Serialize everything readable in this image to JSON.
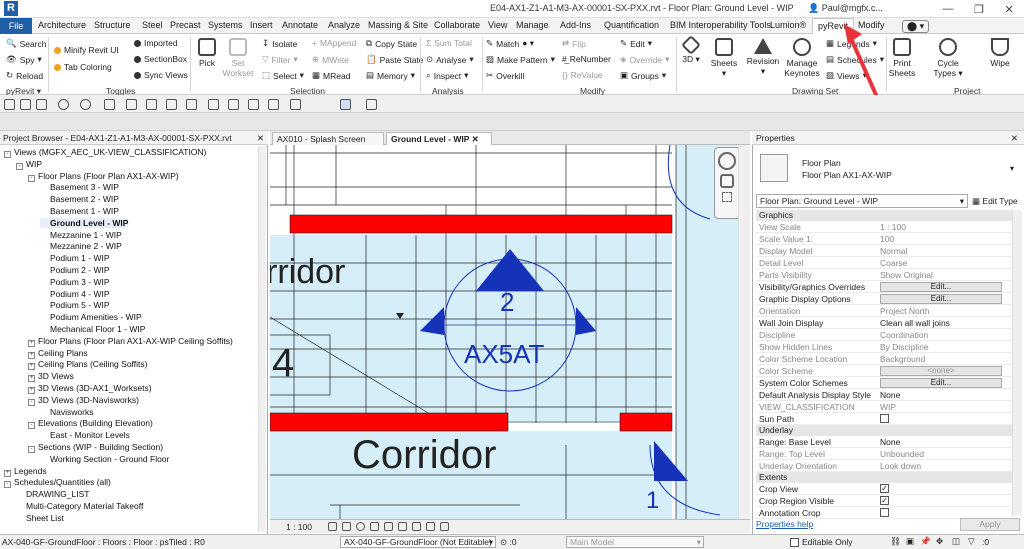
{
  "titlebar": {
    "doc_title": "E04-AX1-Z1-A1-M3-AX-00001-SX-PXX.rvt - Floor Plan: Ground Level - WIP",
    "user": "Paul@mgfx.c..."
  },
  "ribbon_tabs": [
    "Architecture",
    "Structure",
    "Steel",
    "Precast",
    "Systems",
    "Insert",
    "Annotate",
    "Analyze",
    "Massing & Site",
    "Collaborate",
    "View",
    "Manage",
    "Add-Ins",
    "Quantification",
    "BIM Interoperability Tools",
    "Lumion®",
    "pyRevit",
    "Modify"
  ],
  "file_tab": "File",
  "ribbon": {
    "pyrevit_small": {
      "search": "Search",
      "spy": "Spy",
      "reload": "Reload",
      "menu": "pyRevit"
    },
    "toggles": {
      "minify": "Minify Revit UI",
      "tab_coloring": "Tab Coloring",
      "imported": "Imported",
      "sectionbox": "SectionBox",
      "sync_views": "Sync Views",
      "label": "Toggles"
    },
    "selection": {
      "pick": "Pick",
      "set_workset": "Set Workset",
      "isolate": "Isolate",
      "filter": "Filter",
      "select": "Select",
      "mappend": "MAppend",
      "mwrite": "MWrite",
      "mread": "MRead",
      "copy_state": "Copy State",
      "paste_state": "Paste State",
      "memory": "Memory",
      "label": "Selection"
    },
    "analysis": {
      "sum_total": "Sum Total",
      "analyse": "Analyse",
      "inspect": "Inspect",
      "label": "Analysis"
    },
    "modify": {
      "match": "Match",
      "make_pattern": "Make Pattern",
      "overkill": "Overkill",
      "flip": "Flip",
      "renumber": "ReNumber",
      "revalue": "ReValue",
      "edit": "Edit",
      "override": "Override",
      "groups": "Groups",
      "label": "Modify"
    },
    "drawing_set": {
      "three_d": "3D",
      "sheets": "Sheets",
      "revision": "Revision",
      "manage_keynotes": "Manage Keynotes",
      "legends": "Legends",
      "schedules": "Schedules",
      "views": "Views",
      "label": "Drawing Set"
    },
    "project": {
      "print_sheets": "Print Sheets",
      "cycle_types": "Cycle Types",
      "wipe": "Wipe",
      "label": "Project"
    }
  },
  "project_browser": {
    "title": "Project Browser - E04-AX1-Z1-A1-M3-AX-00001-SX-PXX.rvt",
    "items": [
      {
        "label": "Views (MGFX_AEC_UK-VIEW_CLASSIFICATION)",
        "level": 0,
        "toggle": "-"
      },
      {
        "label": "WIP",
        "level": 1,
        "toggle": "-"
      },
      {
        "label": "Floor Plans (Floor Plan AX1-AX-WIP)",
        "level": 2,
        "toggle": "-"
      },
      {
        "label": "Basement 3 - WIP",
        "level": 3,
        "toggle": ""
      },
      {
        "label": "Basement 2 - WIP",
        "level": 3,
        "toggle": ""
      },
      {
        "label": "Basement 1 - WIP",
        "level": 3,
        "toggle": ""
      },
      {
        "label": "Ground Level - WIP",
        "level": 3,
        "toggle": "",
        "bold": true
      },
      {
        "label": "Mezzanine 1 - WIP",
        "level": 3,
        "toggle": ""
      },
      {
        "label": "Mezzanine 2 - WIP",
        "level": 3,
        "toggle": ""
      },
      {
        "label": "Podium 1 - WIP",
        "level": 3,
        "toggle": ""
      },
      {
        "label": "Podium 2 - WIP",
        "level": 3,
        "toggle": ""
      },
      {
        "label": "Podium 3 - WIP",
        "level": 3,
        "toggle": ""
      },
      {
        "label": "Podium 4 - WIP",
        "level": 3,
        "toggle": ""
      },
      {
        "label": "Podium 5 - WIP",
        "level": 3,
        "toggle": ""
      },
      {
        "label": "Podium Amenities - WIP",
        "level": 3,
        "toggle": ""
      },
      {
        "label": "Mechanical Floor 1 - WIP",
        "level": 3,
        "toggle": ""
      },
      {
        "label": "Floor Plans (Floor Plan AX1-AX-WIP Ceiling Soffits)",
        "level": 2,
        "toggle": "+"
      },
      {
        "label": "Ceiling Plans",
        "level": 2,
        "toggle": "+"
      },
      {
        "label": "Ceiling Plans (Ceiling Soffits)",
        "level": 2,
        "toggle": "+"
      },
      {
        "label": "3D Views",
        "level": 2,
        "toggle": "+"
      },
      {
        "label": "3D Views (3D-AX1_Worksets)",
        "level": 2,
        "toggle": "+"
      },
      {
        "label": "3D Views (3D-Navisworks)",
        "level": 2,
        "toggle": "-"
      },
      {
        "label": "Navisworks",
        "level": 3,
        "toggle": ""
      },
      {
        "label": "Elevations (Building Elevation)",
        "level": 2,
        "toggle": "-"
      },
      {
        "label": "East - Monitor Levels",
        "level": 3,
        "toggle": ""
      },
      {
        "label": "Sections (WIP - Building Section)",
        "level": 2,
        "toggle": "-"
      },
      {
        "label": "Working Section - Ground Floor",
        "level": 3,
        "toggle": ""
      },
      {
        "label": "Legends",
        "level": 0,
        "toggle": "+"
      },
      {
        "label": "Schedules/Quantities (all)",
        "level": 0,
        "toggle": "-"
      },
      {
        "label": "DRAWING_LIST",
        "level": 1,
        "toggle": ""
      },
      {
        "label": "Multi-Category Material Takeoff",
        "level": 1,
        "toggle": ""
      },
      {
        "label": "Sheet List",
        "level": 1,
        "toggle": ""
      }
    ]
  },
  "view_tabs": [
    {
      "label": "AX010 - Splash Screen",
      "active": false
    },
    {
      "label": "Ground Level - WIP",
      "active": true
    }
  ],
  "view": {
    "room_top": "rridor",
    "room_bottom": "Corridor",
    "room_number": "4",
    "tag_number": "2",
    "tag_code": "AX5AT",
    "tag_number_2": "1",
    "scale": "1 : 100"
  },
  "properties": {
    "title": "Properties",
    "type_line1": "Floor Plan",
    "type_line2": "Floor Plan AX1-AX-WIP",
    "selector": "Floor Plan: Ground Level - WIP",
    "edit_type": "Edit Type",
    "groups": [
      {
        "name": "Graphics",
        "rows": [
          {
            "k": "View Scale",
            "v": "1 : 100",
            "ro": true
          },
          {
            "k": "Scale Value    1:",
            "v": "100",
            "ro": true
          },
          {
            "k": "Display Model",
            "v": "Normal",
            "ro": true
          },
          {
            "k": "Detail Level",
            "v": "Coarse",
            "ro": true
          },
          {
            "k": "Parts Visibility",
            "v": "Show Original",
            "ro": true
          },
          {
            "k": "Visibility/Graphics Overrides",
            "btn": "Edit..."
          },
          {
            "k": "Graphic Display Options",
            "btn": "Edit..."
          },
          {
            "k": "Orientation",
            "v": "Project North",
            "ro": true
          },
          {
            "k": "Wall Join Display",
            "v": "Clean all wall joins"
          },
          {
            "k": "Discipline",
            "v": "Coordination",
            "ro": true
          },
          {
            "k": "Show Hidden Lines",
            "v": "By Discipline",
            "ro": true
          },
          {
            "k": "Color Scheme Location",
            "v": "Background",
            "ro": true
          },
          {
            "k": "Color Scheme",
            "btn": "<none>",
            "ro": true
          },
          {
            "k": "System Color Schemes",
            "btn": "Edit..."
          },
          {
            "k": "Default Analysis Display Style",
            "v": "None"
          },
          {
            "k": "VIEW_CLASSIFICATION",
            "v": "WIP",
            "ro": true
          },
          {
            "k": "Sun Path",
            "chk": false
          }
        ]
      },
      {
        "name": "Underlay",
        "rows": [
          {
            "k": "Range: Base Level",
            "v": "None"
          },
          {
            "k": "Range: Top Level",
            "v": "Unbounded",
            "ro": true
          },
          {
            "k": "Underlay Orientation",
            "v": "Look down",
            "ro": true
          }
        ]
      },
      {
        "name": "Extents",
        "rows": [
          {
            "k": "Crop View",
            "chk": true
          },
          {
            "k": "Crop Region Visible",
            "chk": true
          },
          {
            "k": "Annotation Crop",
            "chk": false
          }
        ]
      }
    ],
    "help": "Properties help",
    "apply": "Apply"
  },
  "statusbar": {
    "left": "AX-040-GF-GroundFloor : Floors : Floor : psTiled : R0",
    "workset": "AX-040-GF-GroundFloor (Not Editable)",
    "zero1": ":0",
    "design_option": "Main Model",
    "editable_only": "Editable Only",
    "zero2": ":0"
  },
  "colors": {
    "accent": "#1f5fa8",
    "wall_red": "#ff0000",
    "room_fill": "#d6eef7",
    "tag_blue": "#1433b8",
    "arrow": "#e8333a"
  }
}
